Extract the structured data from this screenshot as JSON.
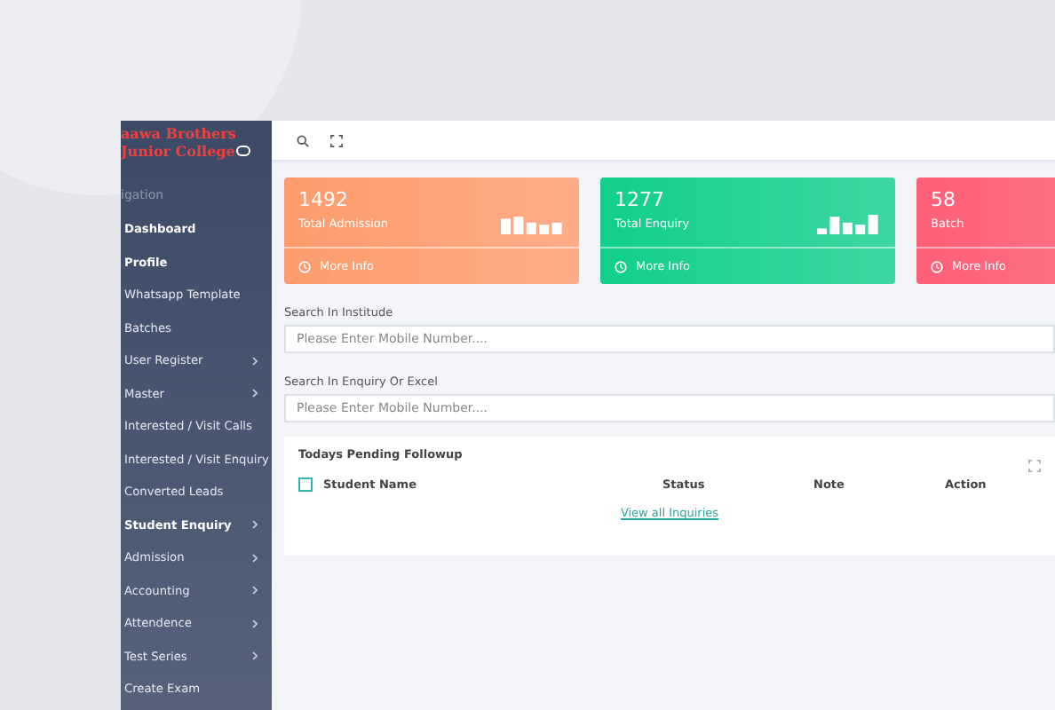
{
  "sidebar": {
    "logo": {
      "line_1": "aawa Brothers",
      "line_2": "Junior College"
    },
    "heading": "igation",
    "items": [
      {
        "label": "Dashboard",
        "active": true,
        "expandable": false
      },
      {
        "label": "Profile",
        "active": true,
        "expandable": false
      },
      {
        "label": "Whatsapp Template",
        "active": false,
        "expandable": false
      },
      {
        "label": "Batches",
        "active": false,
        "expandable": false
      },
      {
        "label": "User Register",
        "active": false,
        "expandable": true
      },
      {
        "label": "Master",
        "active": false,
        "expandable": true
      },
      {
        "label": "Interested / Visit Calls",
        "active": false,
        "expandable": false
      },
      {
        "label": "Interested / Visit Enquiry",
        "active": false,
        "expandable": false
      },
      {
        "label": "Converted Leads",
        "active": false,
        "expandable": false
      },
      {
        "label": "Student Enquiry",
        "active": true,
        "expandable": true
      },
      {
        "label": "Admission",
        "active": false,
        "expandable": true
      },
      {
        "label": "Accounting",
        "active": false,
        "expandable": true
      },
      {
        "label": "Attendence",
        "active": false,
        "expandable": true
      },
      {
        "label": "Test Series",
        "active": false,
        "expandable": true
      },
      {
        "label": "Create Exam",
        "active": false,
        "expandable": false
      }
    ]
  },
  "stat_cards": [
    {
      "value": "1492",
      "label": "Total Admission",
      "link": "More Info",
      "color": "#fe9b6c"
    },
    {
      "value": "1277",
      "label": "Total Enquiry",
      "link": "More Info",
      "color": "#11cf8b"
    },
    {
      "value": "58",
      "label": "Batch",
      "link": "More Info",
      "color": "#fe5f76"
    }
  ],
  "search_fields": [
    {
      "label": "Search In Institude",
      "placeholder": "Please Enter Mobile Number...."
    },
    {
      "label": "Search In Enquiry Or Excel",
      "placeholder": "Please Enter Mobile Number...."
    }
  ],
  "followup": {
    "title": "Todays Pending Followup",
    "select_all_checked": false,
    "columns": [
      "Student Name",
      "Status",
      "Note",
      "Action"
    ],
    "link": "View all Inquiries"
  }
}
